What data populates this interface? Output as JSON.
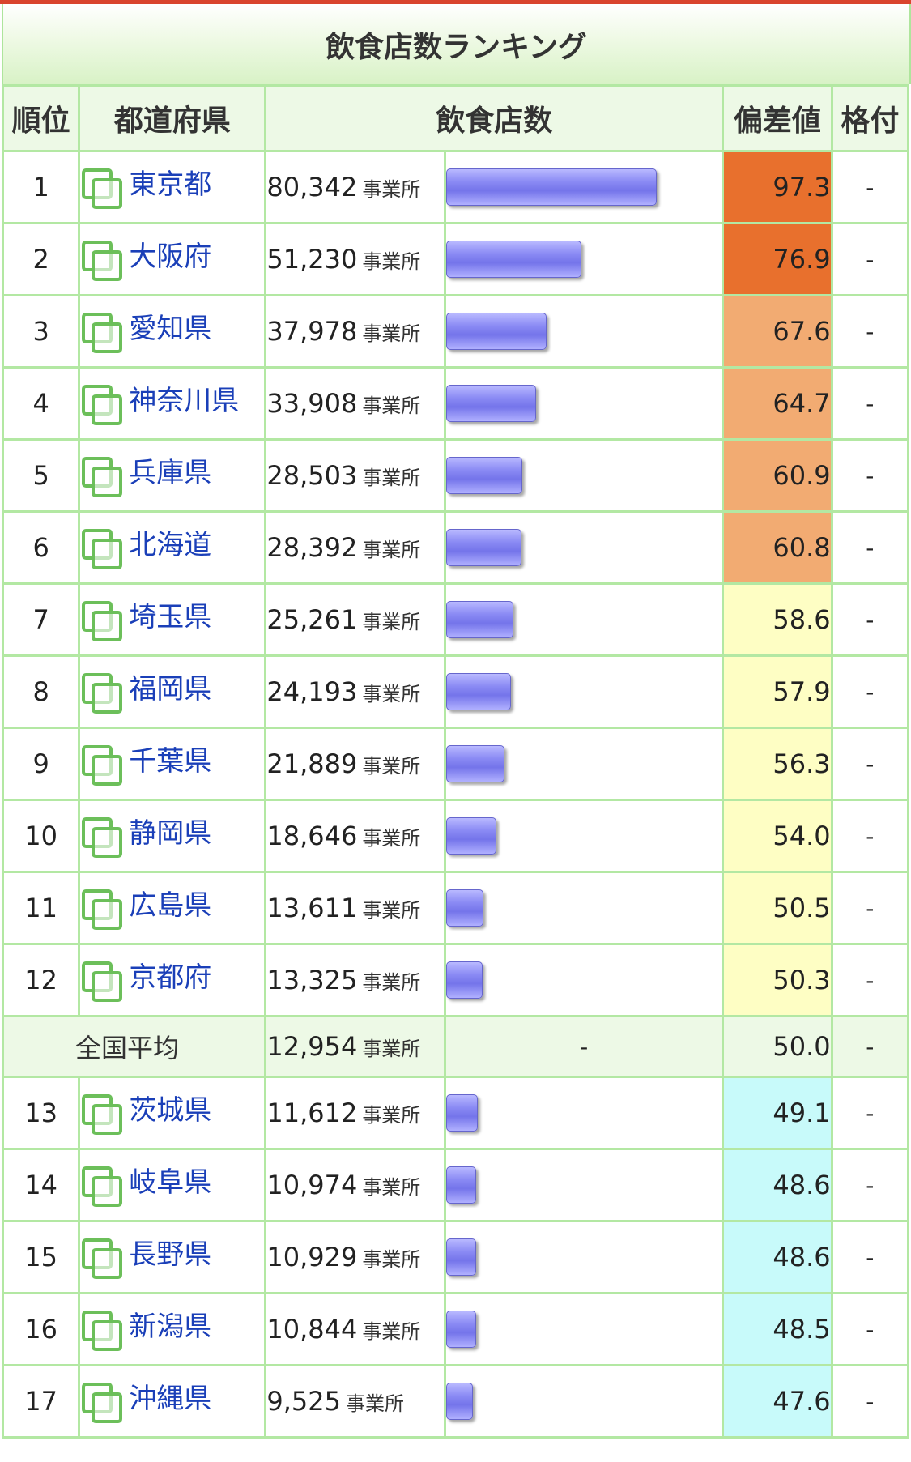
{
  "title": "飲食店数ランキング",
  "headers": {
    "rank": "順位",
    "prefecture": "都道府県",
    "count": "飲食店数",
    "deviation": "偏差値",
    "grade": "格付"
  },
  "unit": "事業所",
  "max_count": 80342,
  "rows": [
    {
      "rank": "1",
      "pref": "東京都",
      "count": "80,342",
      "value": 80342,
      "deviation": "97.3",
      "grade": "-",
      "color": "#e8702d"
    },
    {
      "rank": "2",
      "pref": "大阪府",
      "count": "51,230",
      "value": 51230,
      "deviation": "76.9",
      "grade": "-",
      "color": "#e8702d"
    },
    {
      "rank": "3",
      "pref": "愛知県",
      "count": "37,978",
      "value": 37978,
      "deviation": "67.6",
      "grade": "-",
      "color": "#f2ab72"
    },
    {
      "rank": "4",
      "pref": "神奈川県",
      "count": "33,908",
      "value": 33908,
      "deviation": "64.7",
      "grade": "-",
      "color": "#f2ab72"
    },
    {
      "rank": "5",
      "pref": "兵庫県",
      "count": "28,503",
      "value": 28503,
      "deviation": "60.9",
      "grade": "-",
      "color": "#f2ab72"
    },
    {
      "rank": "6",
      "pref": "北海道",
      "count": "28,392",
      "value": 28392,
      "deviation": "60.8",
      "grade": "-",
      "color": "#f2ab72"
    },
    {
      "rank": "7",
      "pref": "埼玉県",
      "count": "25,261",
      "value": 25261,
      "deviation": "58.6",
      "grade": "-",
      "color": "#fefec4"
    },
    {
      "rank": "8",
      "pref": "福岡県",
      "count": "24,193",
      "value": 24193,
      "deviation": "57.9",
      "grade": "-",
      "color": "#fefec4"
    },
    {
      "rank": "9",
      "pref": "千葉県",
      "count": "21,889",
      "value": 21889,
      "deviation": "56.3",
      "grade": "-",
      "color": "#fefec4"
    },
    {
      "rank": "10",
      "pref": "静岡県",
      "count": "18,646",
      "value": 18646,
      "deviation": "54.0",
      "grade": "-",
      "color": "#fefec4"
    },
    {
      "rank": "11",
      "pref": "広島県",
      "count": "13,611",
      "value": 13611,
      "deviation": "50.5",
      "grade": "-",
      "color": "#fefec4"
    },
    {
      "rank": "12",
      "pref": "京都府",
      "count": "13,325",
      "value": 13325,
      "deviation": "50.3",
      "grade": "-",
      "color": "#fefec4"
    },
    {
      "type": "average",
      "label": "全国平均",
      "count": "12,954",
      "bar": "-",
      "deviation": "50.0",
      "grade": "-"
    },
    {
      "rank": "13",
      "pref": "茨城県",
      "count": "11,612",
      "value": 11612,
      "deviation": "49.1",
      "grade": "-",
      "color": "#c8fafa"
    },
    {
      "rank": "14",
      "pref": "岐阜県",
      "count": "10,974",
      "value": 10974,
      "deviation": "48.6",
      "grade": "-",
      "color": "#c8fafa"
    },
    {
      "rank": "15",
      "pref": "長野県",
      "count": "10,929",
      "value": 10929,
      "deviation": "48.6",
      "grade": "-",
      "color": "#c8fafa"
    },
    {
      "rank": "16",
      "pref": "新潟県",
      "count": "10,844",
      "value": 10844,
      "deviation": "48.5",
      "grade": "-",
      "color": "#c8fafa"
    },
    {
      "rank": "17",
      "pref": "沖縄県",
      "count": "9,525",
      "value": 9525,
      "deviation": "47.6",
      "grade": "-",
      "color": "#c8fafa"
    }
  ]
}
